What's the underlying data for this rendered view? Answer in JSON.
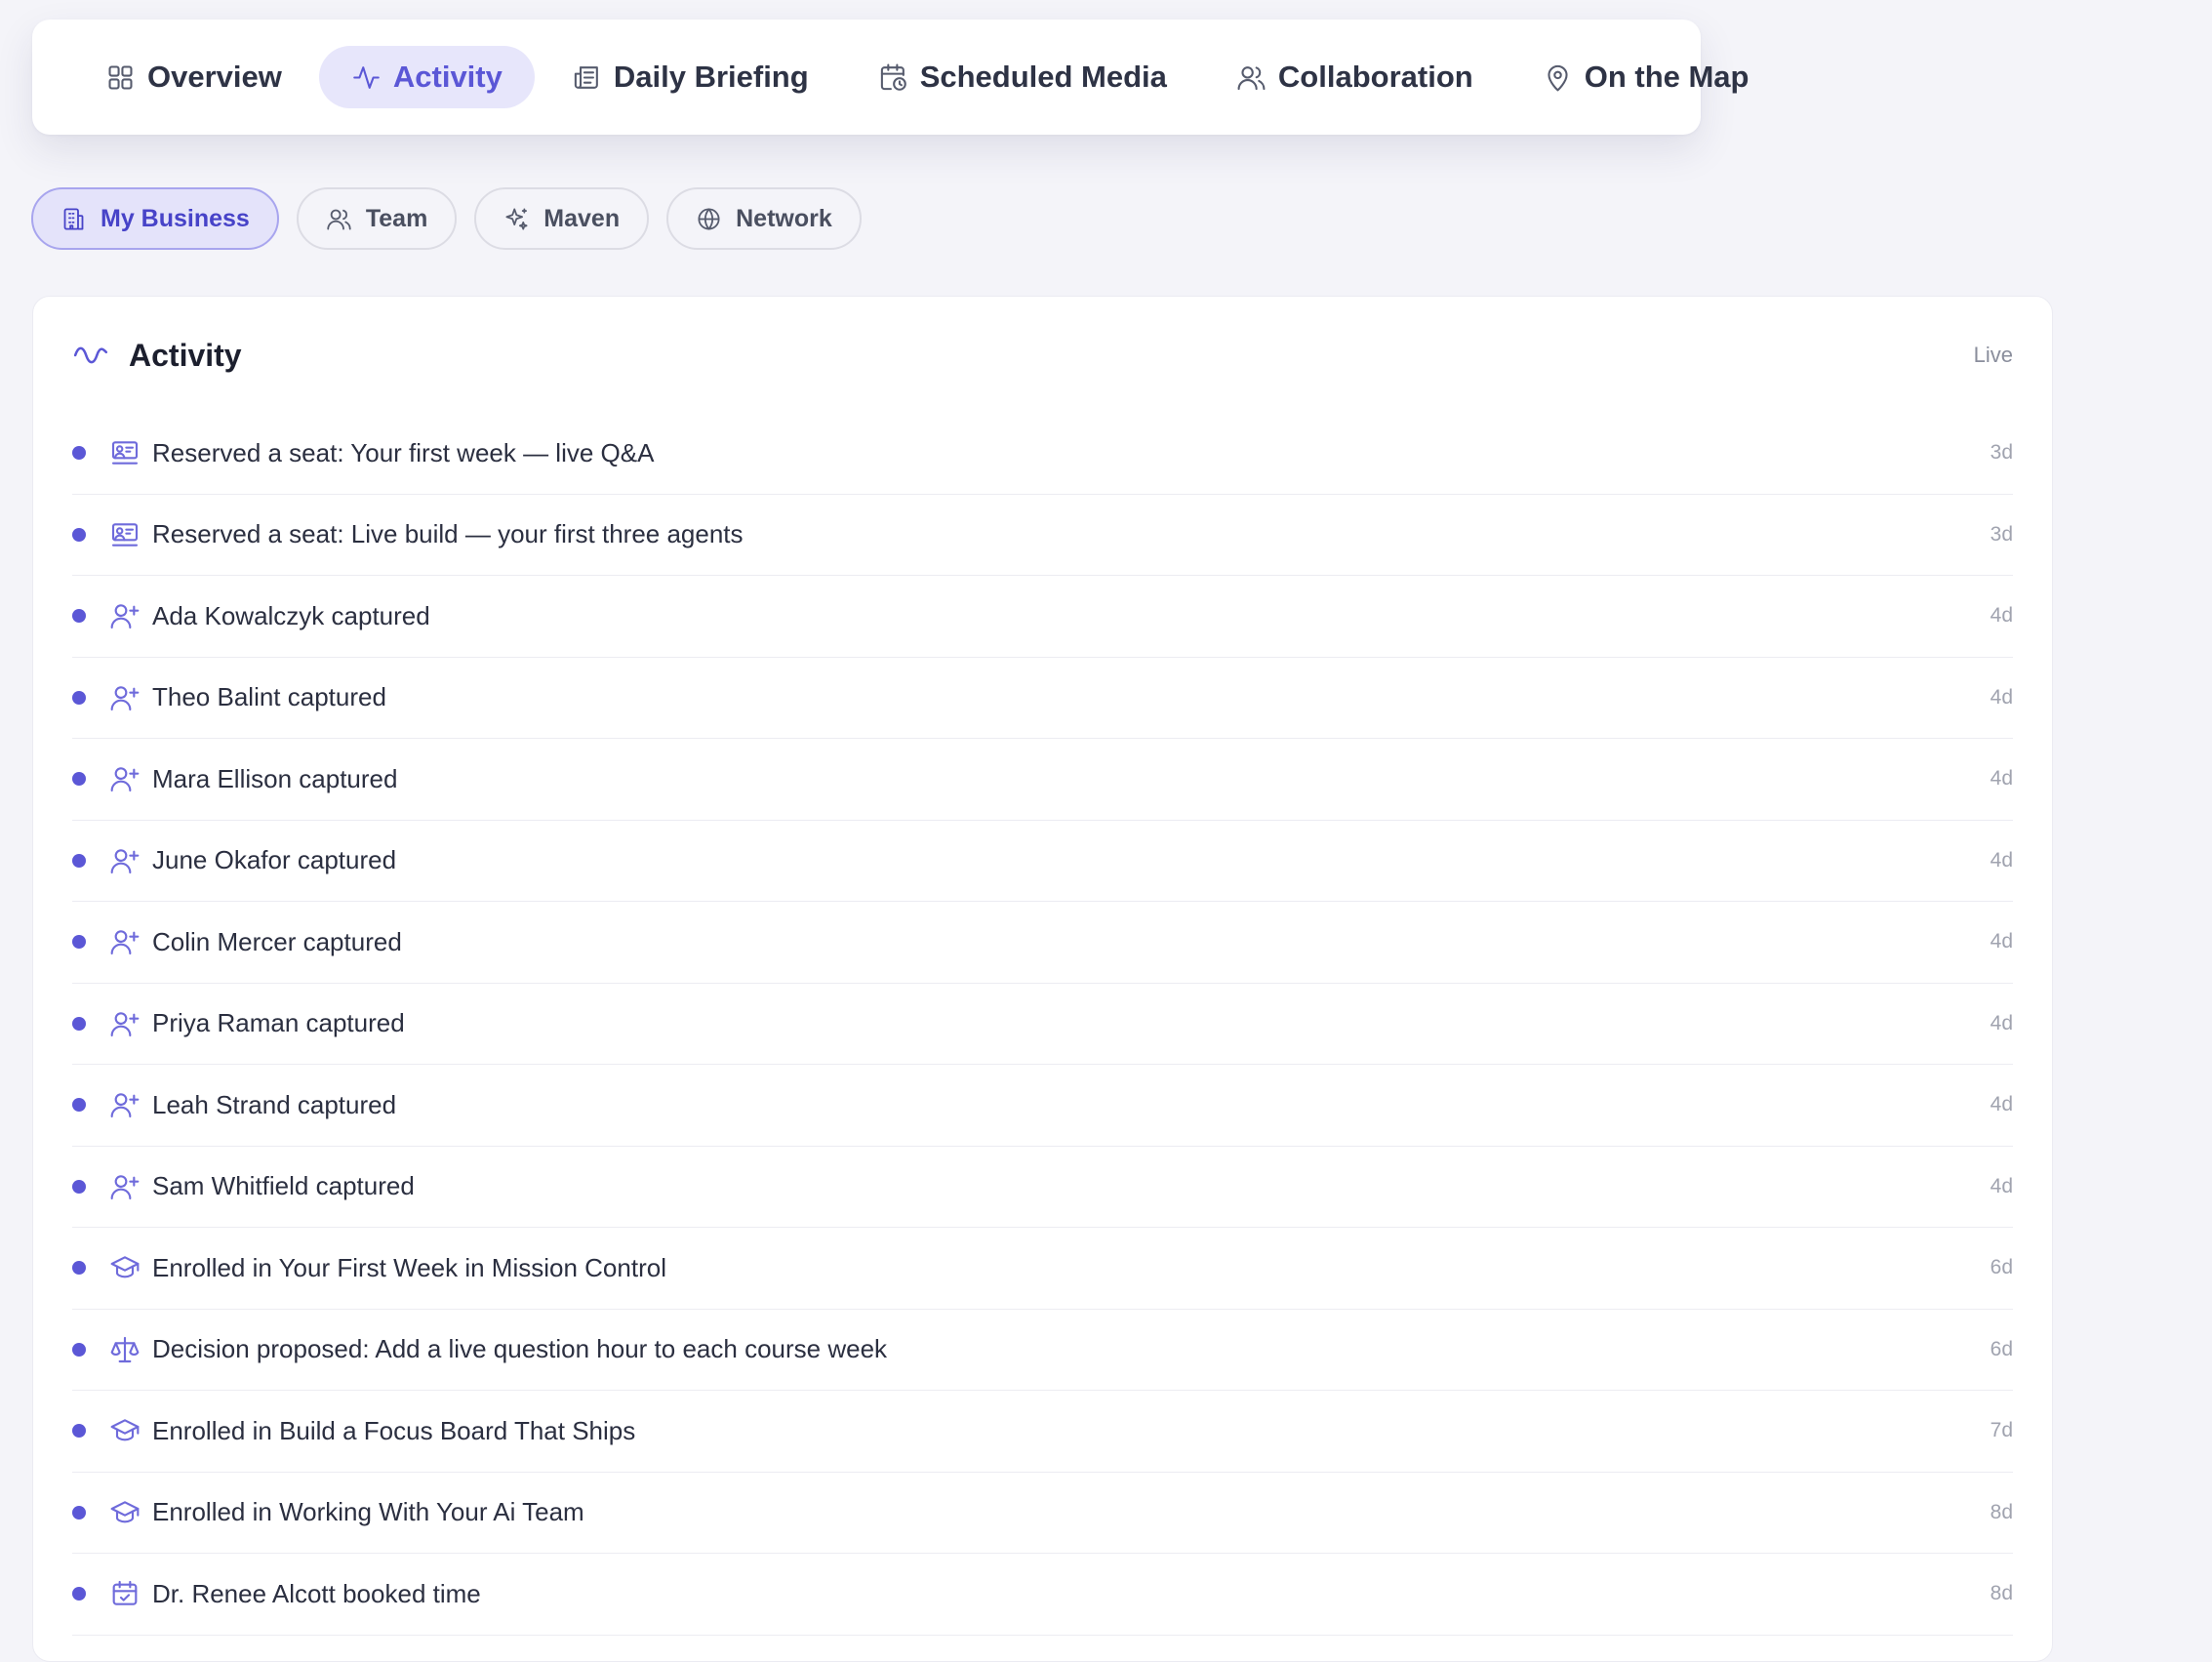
{
  "tabs": [
    {
      "label": "Overview",
      "icon": "grid-icon",
      "active": false
    },
    {
      "label": "Activity",
      "icon": "pulse-icon",
      "active": true
    },
    {
      "label": "Daily Briefing",
      "icon": "newspaper-icon",
      "active": false
    },
    {
      "label": "Scheduled Media",
      "icon": "calendar-clock-icon",
      "active": false
    },
    {
      "label": "Collaboration",
      "icon": "users-icon",
      "active": false
    },
    {
      "label": "On the Map",
      "icon": "map-pin-icon",
      "active": false
    }
  ],
  "filters": [
    {
      "label": "My Business",
      "icon": "building-icon",
      "active": true
    },
    {
      "label": "Team",
      "icon": "users-icon",
      "active": false
    },
    {
      "label": "Maven",
      "icon": "sparkles-icon",
      "active": false
    },
    {
      "label": "Network",
      "icon": "globe-icon",
      "active": false
    }
  ],
  "activity": {
    "title": "Activity",
    "status": "Live",
    "accent": "#5b57d6",
    "items": [
      {
        "text": "Reserved a seat: Your first week — live Q&A",
        "time": "3d",
        "icon": "presentation-icon"
      },
      {
        "text": "Reserved a seat: Live build — your first three agents",
        "time": "3d",
        "icon": "presentation-icon"
      },
      {
        "text": "Ada Kowalczyk captured",
        "time": "4d",
        "icon": "user-plus-icon"
      },
      {
        "text": "Theo Balint captured",
        "time": "4d",
        "icon": "user-plus-icon"
      },
      {
        "text": "Mara Ellison captured",
        "time": "4d",
        "icon": "user-plus-icon"
      },
      {
        "text": "June Okafor captured",
        "time": "4d",
        "icon": "user-plus-icon"
      },
      {
        "text": "Colin Mercer captured",
        "time": "4d",
        "icon": "user-plus-icon"
      },
      {
        "text": "Priya Raman captured",
        "time": "4d",
        "icon": "user-plus-icon"
      },
      {
        "text": "Leah Strand captured",
        "time": "4d",
        "icon": "user-plus-icon"
      },
      {
        "text": "Sam Whitfield captured",
        "time": "4d",
        "icon": "user-plus-icon"
      },
      {
        "text": "Enrolled in Your First Week in Mission Control",
        "time": "6d",
        "icon": "graduation-cap-icon"
      },
      {
        "text": "Decision proposed: Add a live question hour to each course week",
        "time": "6d",
        "icon": "scale-icon"
      },
      {
        "text": "Enrolled in Build a Focus Board That Ships",
        "time": "7d",
        "icon": "graduation-cap-icon"
      },
      {
        "text": "Enrolled in Working With Your Ai Team",
        "time": "8d",
        "icon": "graduation-cap-icon"
      },
      {
        "text": "Dr. Renee Alcott booked time",
        "time": "8d",
        "icon": "calendar-check-icon"
      }
    ]
  }
}
